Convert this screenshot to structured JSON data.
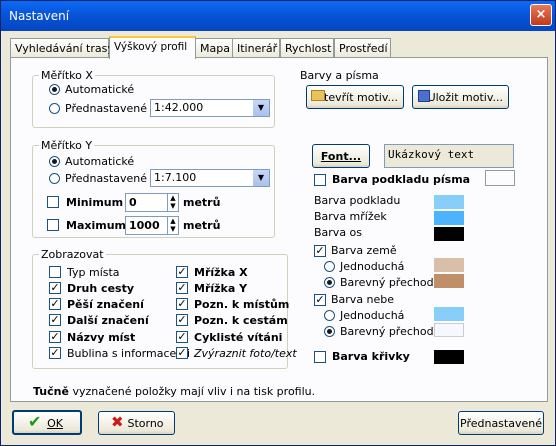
{
  "window": {
    "title": "Nastavení",
    "close_label": "×"
  },
  "tabs": [
    {
      "label": "Vyhledávání trasy"
    },
    {
      "label": "Výškový profil"
    },
    {
      "label": "Mapa"
    },
    {
      "label": "Itinerář"
    },
    {
      "label": "Rychlost"
    },
    {
      "label": "Prostředí"
    }
  ],
  "active_tab": "Výškový profil",
  "scale_x": {
    "title": "Měřítko X",
    "option_auto": "Automatické",
    "option_preset": "Přednastavené",
    "selected": "Automatické",
    "preset_value": "1:42.000"
  },
  "scale_y": {
    "title": "Měřítko Y",
    "option_auto": "Automatické",
    "option_preset": "Přednastavené",
    "selected": "Automatické",
    "preset_value": "1:7.100",
    "minimum_label": "Minimum",
    "minimum_value": "0",
    "maximum_label": "Maximum",
    "maximum_value": "1000",
    "unit": "metrů"
  },
  "display": {
    "title": "Zobrazovat",
    "items": [
      {
        "label": "Typ místa",
        "checked": false,
        "bold": false
      },
      {
        "label": "Druh cesty",
        "checked": true,
        "bold": true
      },
      {
        "label": "Pěší značení",
        "checked": true,
        "bold": true
      },
      {
        "label": "Další značení",
        "checked": true,
        "bold": true
      },
      {
        "label": "Názvy míst",
        "checked": true,
        "bold": true
      },
      {
        "label": "Bublina s informacemi",
        "checked": true,
        "bold": false
      },
      {
        "label": "Mřížka X",
        "checked": true,
        "bold": true
      },
      {
        "label": "Mřížka Y",
        "checked": true,
        "bold": true
      },
      {
        "label": "Pozn. k místům",
        "checked": true,
        "bold": true
      },
      {
        "label": "Pozn. k cestám",
        "checked": true,
        "bold": true
      },
      {
        "label": "Cyklisté vítáni",
        "checked": true,
        "bold": true
      },
      {
        "label": "Zvýraznit foto/text",
        "checked": true,
        "bold": false
      }
    ]
  },
  "colors": {
    "title": "Barvy a písma",
    "open_theme": "Otevřít motiv...",
    "save_theme": "Uložit motiv...",
    "font_button": "Font...",
    "sample_text": "Ukázkový text",
    "font_background_label": "Barva podkladu písma",
    "font_background_checked": false,
    "background_label": "Barva podkladu",
    "background_color": "#87cefa",
    "grid_label": "Barva mřížek",
    "grid_color": "#4db3ff",
    "axes_label": "Barva os",
    "axes_color": "#000000",
    "ground_label": "Barva země",
    "ground_checked": true,
    "ground_simple": "Jednoduchá",
    "ground_gradient": "Barevný přechod",
    "ground_selected": "Barevný přechod",
    "ground_simple_color": "#d9bfa8",
    "ground_gradient_color": "#bf8f6a",
    "sky_label": "Barva nebe",
    "sky_checked": true,
    "sky_simple": "Jednoduchá",
    "sky_gradient": "Barevný přechod",
    "sky_selected": "Barevný přechod",
    "sky_simple_color": "#87cefa",
    "sky_gradient_color": "#f5f9ff",
    "curve_label": "Barva křivky",
    "curve_checked": false,
    "curve_color": "#000000"
  },
  "note": {
    "bold": "Tučně",
    "rest": " vyznačené položky mají vliv i na tisk profilu."
  },
  "buttons": {
    "ok": "OK",
    "cancel": "Storno",
    "defaults": "Přednastavené"
  }
}
